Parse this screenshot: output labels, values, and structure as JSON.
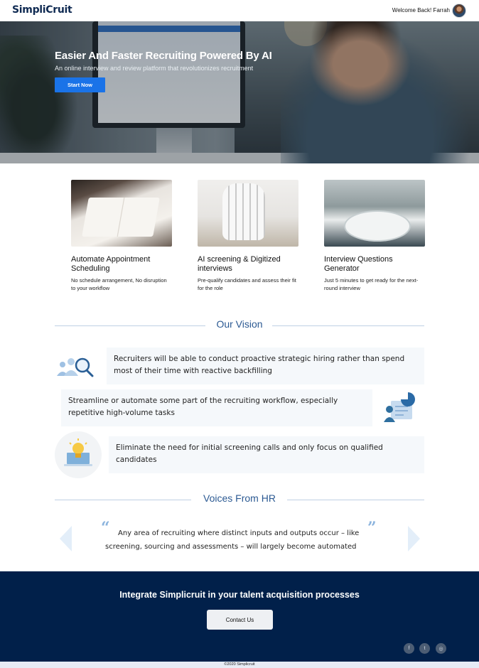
{
  "header": {
    "logo": "SimpliCruit",
    "welcome": "Welcome Back! Farrah"
  },
  "hero": {
    "title": "Easier And Faster Recruiting Powered By AI",
    "subtitle": "An online interview and review platform that revolutionizes recruitment",
    "cta_label": "Start Now"
  },
  "features": [
    {
      "title": "Automate Appointment Scheduling",
      "desc": "No schedule arrangement, No disruption to your workflow"
    },
    {
      "title": "AI screening & Digitized interviews",
      "desc": "Pre-qualify candidates and assess their fit for the role"
    },
    {
      "title": "Interview Questions Generator",
      "desc": "Just 5 minutes to get ready for the next-round interview"
    }
  ],
  "vision": {
    "heading": "Our Vision",
    "items": [
      {
        "text": "Recruiters will be able to conduct proactive strategic hiring rather than spend most of their time with reactive backfilling",
        "icon": "people-search-icon"
      },
      {
        "text": "Streamline or automate some part of the recruiting workflow, especially repetitive high-volume tasks",
        "icon": "person-chart-icon"
      },
      {
        "text": "Eliminate the need for initial screening calls and only focus on qualified candidates",
        "icon": "lightbulb-laptop-icon"
      }
    ]
  },
  "voices": {
    "heading": "Voices From HR",
    "quote": "Any area of recruiting where distinct inputs and outputs occur – like screening, sourcing and assessments – will largely become automated"
  },
  "cta": {
    "title": "Integrate Simplicruit in your talent acquisition processes",
    "button": "Contact Us"
  },
  "social": [
    {
      "glyph": "f",
      "icon": "facebook-icon"
    },
    {
      "glyph": "t",
      "icon": "twitter-icon"
    },
    {
      "glyph": "◎",
      "icon": "instagram-icon"
    }
  ],
  "footer": {
    "copyright": "©2020 Simplicruit"
  },
  "colors": {
    "brand_navy": "#01204a",
    "accent_blue": "#1a73e8",
    "heading_blue": "#2c5a93"
  }
}
